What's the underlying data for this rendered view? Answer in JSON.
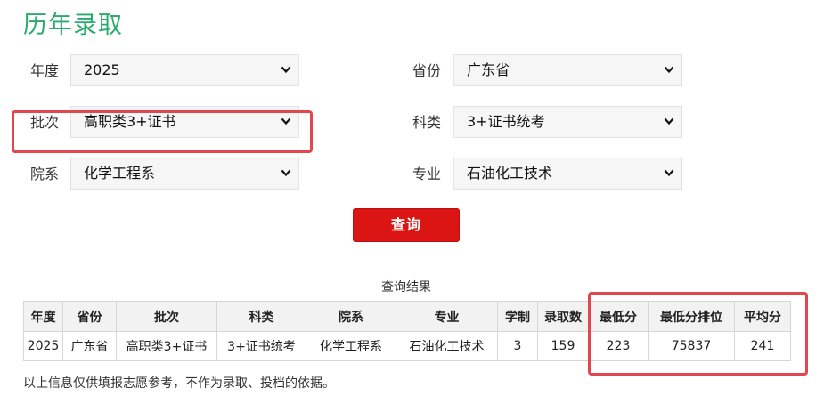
{
  "page": {
    "title": "历年录取"
  },
  "form": {
    "year": {
      "label": "年度",
      "value": "2025"
    },
    "province": {
      "label": "省份",
      "value": "广东省"
    },
    "batch": {
      "label": "批次",
      "value": "高职类3+证书"
    },
    "category": {
      "label": "科类",
      "value": "3+证书统考"
    },
    "department": {
      "label": "院系",
      "value": "化学工程系"
    },
    "major": {
      "label": "专业",
      "value": "石油化工技术"
    },
    "query_button": "查询"
  },
  "results": {
    "caption": "查询结果",
    "columns": [
      "年度",
      "省份",
      "批次",
      "科类",
      "院系",
      "专业",
      "学制",
      "录取数",
      "最低分",
      "最低分排位",
      "平均分"
    ],
    "rows": [
      [
        "2025",
        "广东省",
        "高职类3+证书",
        "3+证书统考",
        "化学工程系",
        "石油化工技术",
        "3",
        "159",
        "223",
        "75837",
        "241"
      ]
    ]
  },
  "footnote": "以上信息仅供填报志愿参考，不作为录取、投档的依据。",
  "colors": {
    "title": "#2bab6e",
    "button": "#db1514",
    "highlight": "#e2474f"
  }
}
